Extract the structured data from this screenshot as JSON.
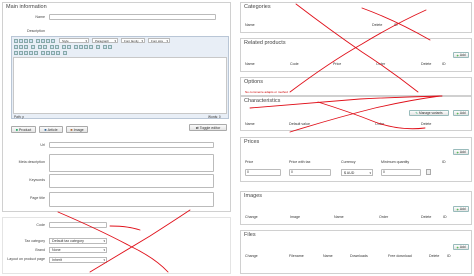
{
  "main_info": {
    "title": "Main information",
    "name_label": "Name",
    "description_label": "Description",
    "editor": {
      "style_value": "Style",
      "format_value": "Paragraph",
      "font_value": "Font family",
      "size_value": "Font size",
      "path_label": "Path: p",
      "words_label": "Words: 0"
    },
    "buttons": {
      "product": "Product",
      "article": "Article",
      "image": "Image",
      "toggle": "Toggle editor"
    },
    "url_label": "Url",
    "meta_desc_label": "Meta description",
    "keywords_label": "Keywords",
    "page_title_label": "Page title"
  },
  "lower_left": {
    "code_label": "Code",
    "tax_label": "Tax category",
    "tax_value": "Default tax category",
    "brand_label": "Brand",
    "brand_value": "None",
    "layout_label": "Layout on product page",
    "layout_value": "Inherit"
  },
  "categories": {
    "title": "Categories",
    "columns": [
      "Name",
      "Delete",
      "ID"
    ]
  },
  "related": {
    "title": "Related products",
    "columns": [
      "Name",
      "Code",
      "Price",
      "Order",
      "Delete",
      "ID"
    ],
    "add_label": "Add"
  },
  "options": {
    "title": "Options",
    "warning": "No commerce adapts or method"
  },
  "characteristics": {
    "title": "Characteristics",
    "columns": [
      "Name",
      "Default value",
      "Order",
      "Delete"
    ],
    "manage_label": "Manage variants",
    "add_label": "Add"
  },
  "prices": {
    "title": "Prices",
    "columns": [
      "Price",
      "Price with tax",
      "Currency",
      "Minimum quantity",
      "ID"
    ],
    "row": {
      "price": "0",
      "price_tax": "0",
      "currency": "$ AUD",
      "min_qty": "0"
    },
    "add_label": "Add"
  },
  "images": {
    "title": "Images",
    "columns": [
      "Change",
      "Image",
      "Name",
      "Order",
      "Delete",
      "ID"
    ],
    "add_label": "Add"
  },
  "files": {
    "title": "Files",
    "columns": [
      "Change",
      "Filename",
      "Name",
      "Downloads",
      "Free download",
      "Delete",
      "ID"
    ],
    "add_label": "Add"
  },
  "annotation_color": "#e0101a"
}
